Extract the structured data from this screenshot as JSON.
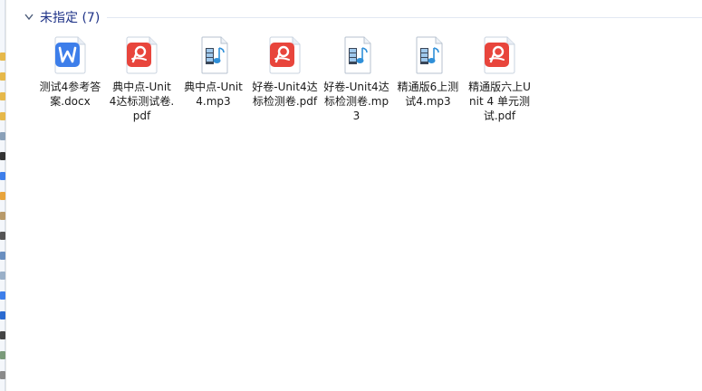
{
  "group": {
    "title": "未指定 (7)"
  },
  "colors": {
    "group_title": "#1e3287",
    "wps_blue": "#3d7eea",
    "pdf_red": "#e8453c",
    "mp3_blue": "#2f8fd8"
  },
  "files": [
    {
      "type": "docx",
      "icon": "wps-writer-doc-icon",
      "name": "测试4参考答案.docx"
    },
    {
      "type": "pdf",
      "icon": "pdf-icon",
      "name": "典中点-Unit 4达标测试卷.pdf"
    },
    {
      "type": "mp3",
      "icon": "mp3-audio-icon",
      "name": "典中点-Unit4.mp3"
    },
    {
      "type": "pdf",
      "icon": "pdf-icon",
      "name": "好卷-Unit4达标检测卷.pdf"
    },
    {
      "type": "mp3",
      "icon": "mp3-audio-icon",
      "name": "好卷-Unit4达标检测卷.mp3"
    },
    {
      "type": "mp3",
      "icon": "mp3-audio-icon",
      "name": "精通版6上测试4.mp3"
    },
    {
      "type": "pdf",
      "icon": "pdf-icon",
      "name": "精通版六上Unit 4 单元测试.pdf"
    }
  ]
}
